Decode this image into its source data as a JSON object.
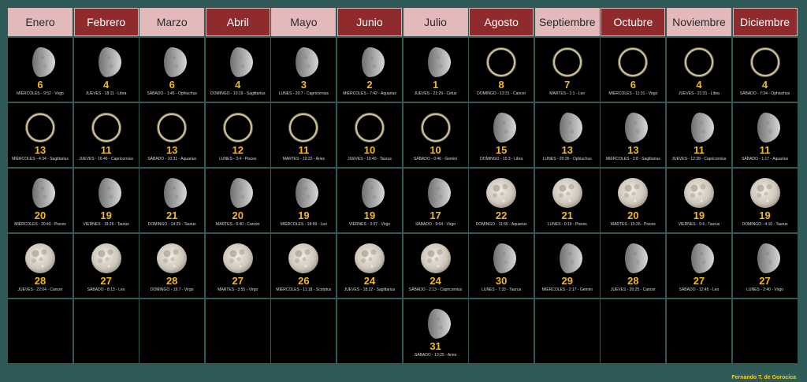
{
  "months": [
    {
      "name": "Enero",
      "style": "light"
    },
    {
      "name": "Febrero",
      "style": "dark"
    },
    {
      "name": "Marzo",
      "style": "light"
    },
    {
      "name": "Abril",
      "style": "dark"
    },
    {
      "name": "Mayo",
      "style": "light"
    },
    {
      "name": "Junio",
      "style": "dark"
    },
    {
      "name": "Julio",
      "style": "light"
    },
    {
      "name": "Agosto",
      "style": "dark"
    },
    {
      "name": "Septiembre",
      "style": "light"
    },
    {
      "name": "Octubre",
      "style": "dark"
    },
    {
      "name": "Noviembre",
      "style": "light"
    },
    {
      "name": "Diciembre",
      "style": "dark"
    }
  ],
  "rows": [
    [
      {
        "phase": "quarter",
        "day": "6",
        "info": "MIÉRCOLES - 9:52 - Virgo"
      },
      {
        "phase": "quarter",
        "day": "4",
        "info": "JUEVES - 18:11 - Libra"
      },
      {
        "phase": "quarter",
        "day": "6",
        "info": "SÁBADO - 1:45 - Ophiuchus"
      },
      {
        "phase": "quarter",
        "day": "4",
        "info": "DOMINGO - 10:19 - Sagittarius"
      },
      {
        "phase": "quarter",
        "day": "3",
        "info": "LUNES - 20:7 - Capricornius"
      },
      {
        "phase": "quarter",
        "day": "2",
        "info": "MIÉRCOLES - 7:42 - Aquarius"
      },
      {
        "phase": "quarter",
        "day": "1",
        "info": "JUEVES - 21:29 - Cetus"
      },
      {
        "phase": "new",
        "day": "8",
        "info": "DOMINGO - 13:31 - Cancer"
      },
      {
        "phase": "new",
        "day": "7",
        "info": "MARTES - 1:1 - Leo"
      },
      {
        "phase": "new",
        "day": "6",
        "info": "MIÉRCOLES - 11:31 - Virgo"
      },
      {
        "phase": "new",
        "day": "4",
        "info": "JUEVES - 21:31 - Libra"
      },
      {
        "phase": "new",
        "day": "4",
        "info": "SÁBADO - 7:34 - Ophiuchus"
      }
    ],
    [
      {
        "phase": "new",
        "day": "13",
        "info": "MIÉRCOLES - 4:34 - Sagittarius"
      },
      {
        "phase": "new",
        "day": "11",
        "info": "JUEVES - 16:46 - Capricornius"
      },
      {
        "phase": "new",
        "day": "13",
        "info": "SÁBADO - 10:31 - Aquarius"
      },
      {
        "phase": "new",
        "day": "12",
        "info": "LUNES - 3:4 - Pisces"
      },
      {
        "phase": "new",
        "day": "11",
        "info": "MARTES - 19:22 - Aries"
      },
      {
        "phase": "new",
        "day": "10",
        "info": "JUEVES - 19:40 - Taurus"
      },
      {
        "phase": "new",
        "day": "10",
        "info": "SÁBADO - 0:46 - Gemini"
      },
      {
        "phase": "quarter",
        "day": "15",
        "info": "DOMINGO - 15:3 - Libra"
      },
      {
        "phase": "quarter",
        "day": "13",
        "info": "LUNES - 20:26 - Ophiuchus"
      },
      {
        "phase": "quarter",
        "day": "13",
        "info": "MIÉRCOLES - 3:8 - Sagittarius"
      },
      {
        "phase": "quarter",
        "day": "11",
        "info": "JUEVES - 12:28 - Capricornius"
      },
      {
        "phase": "quarter",
        "day": "11",
        "info": "SÁBADO - 1:17 - Aquarius"
      }
    ],
    [
      {
        "phase": "quarter",
        "day": "20",
        "info": "MIÉRCOLES - 20:40 - Pisces"
      },
      {
        "phase": "quarter",
        "day": "19",
        "info": "VIERNES - 19:26 - Taurus"
      },
      {
        "phase": "quarter",
        "day": "21",
        "info": "DOMINGO - 14:29 - Taurus"
      },
      {
        "phase": "quarter",
        "day": "20",
        "info": "MARTES - 6:40 - Cancer"
      },
      {
        "phase": "quarter",
        "day": "19",
        "info": "MIÉRCOLES - 18:59 - Leo"
      },
      {
        "phase": "quarter",
        "day": "19",
        "info": "VIERNES - 3:37 - Virgo"
      },
      {
        "phase": "quarter",
        "day": "17",
        "info": "SÁBADO - 9:54 - Virgo"
      },
      {
        "phase": "full",
        "day": "22",
        "info": "DOMINGO - 11:55 - Aquarius"
      },
      {
        "phase": "full",
        "day": "21",
        "info": "LUNES - 0:19 - Pisces"
      },
      {
        "phase": "full",
        "day": "20",
        "info": "MARTES - 15:26 - Pisces"
      },
      {
        "phase": "full",
        "day": "19",
        "info": "VIERNES - 9:4 - Taurus"
      },
      {
        "phase": "full",
        "day": "19",
        "info": "DOMINGO - 4:10 - Taurus"
      }
    ],
    [
      {
        "phase": "full",
        "day": "28",
        "info": "JUEVES - 22:04 - Cancer"
      },
      {
        "phase": "full",
        "day": "27",
        "info": "SÁBADO - 8:13 - Leo"
      },
      {
        "phase": "full",
        "day": "28",
        "info": "DOMINGO - 19:7 - Virgo"
      },
      {
        "phase": "full",
        "day": "27",
        "info": "MARTES - 3:55 - Virgo"
      },
      {
        "phase": "full",
        "day": "26",
        "info": "MIÉRCOLES - 11:18 - Scorpius"
      },
      {
        "phase": "full",
        "day": "24",
        "info": "JUEVES - 18:22 - Sagittarius"
      },
      {
        "phase": "full",
        "day": "24",
        "info": "SÁBADO - 2:13 - Capricornius"
      },
      {
        "phase": "quarter",
        "day": "30",
        "info": "LUNES - 7:33 - Taurus"
      },
      {
        "phase": "quarter",
        "day": "29",
        "info": "MIÉRCOLES - 2:17 - Gemini"
      },
      {
        "phase": "quarter",
        "day": "28",
        "info": "JUEVES - 20:25 - Cancer"
      },
      {
        "phase": "quarter",
        "day": "27",
        "info": "SÁBADO - 12:45 - Leo"
      },
      {
        "phase": "quarter",
        "day": "27",
        "info": "LUNES - 2:40 - Virgo"
      }
    ],
    [
      null,
      null,
      null,
      null,
      null,
      null,
      {
        "phase": "quarter",
        "day": "31",
        "info": "SÁBADO - 13:25 - Aries"
      },
      null,
      null,
      null,
      null,
      null
    ]
  ],
  "colors": {
    "day": "#f3b820",
    "header_light": "#e4b9bb",
    "header_dark": "#8f2b2c",
    "background": "#2f5a57"
  },
  "credit": "Fernando T. de Gorocica"
}
